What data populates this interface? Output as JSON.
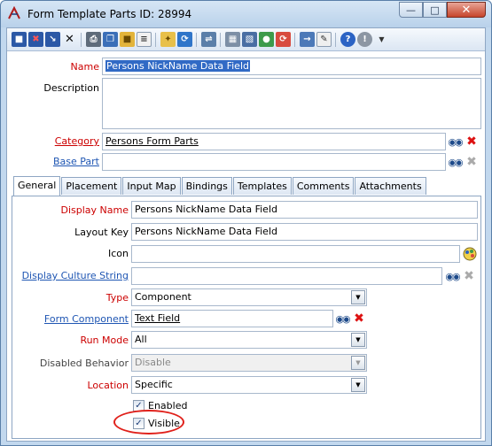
{
  "window": {
    "title": "Form Template Parts ID: 28994",
    "minimize": "—",
    "maximize": "□",
    "close": "✕"
  },
  "toolbar": {
    "icons": [
      "save-icon",
      "save-delete-icon",
      "save-close-icon",
      "delete-icon",
      "print-icon",
      "copy-icon",
      "open-folder-icon",
      "notes-icon",
      "wand-icon",
      "refresh-icon",
      "link-icon",
      "layout-icon",
      "layout2-icon",
      "globe-icon",
      "sync-icon",
      "arrow-in-icon",
      "edit-icon",
      "help-icon",
      "info-icon",
      "more-icon"
    ]
  },
  "form": {
    "name_label": "Name",
    "name_value": "Persons NickName Data Field",
    "description_label": "Description",
    "description_value": "",
    "category_label": "Category",
    "category_value": "Persons Form Parts",
    "base_part_label": "Base Part",
    "base_part_value": ""
  },
  "tabs": [
    "General",
    "Placement",
    "Input Map",
    "Bindings",
    "Templates",
    "Comments",
    "Attachments"
  ],
  "general": {
    "display_name_label": "Display Name",
    "display_name_value": "Persons NickName Data Field",
    "layout_key_label": "Layout Key",
    "layout_key_value": "Persons NickName Data Field",
    "icon_label": "Icon",
    "icon_value": "",
    "culture_label": "Display Culture String",
    "culture_value": "",
    "type_label": "Type",
    "type_value": "Component",
    "form_component_label": "Form Component",
    "form_component_value": "Text Field",
    "run_mode_label": "Run Mode",
    "run_mode_value": "All",
    "disabled_behavior_label": "Disabled Behavior",
    "disabled_behavior_value": "Disable",
    "location_label": "Location",
    "location_value": "Specific",
    "enabled_label": "Enabled",
    "enabled_checked": true,
    "visible_label": "Visible",
    "visible_checked": true
  },
  "colors": {
    "required": "#cc0000",
    "link": "#1f56b3",
    "highlight": "#e0201a"
  }
}
